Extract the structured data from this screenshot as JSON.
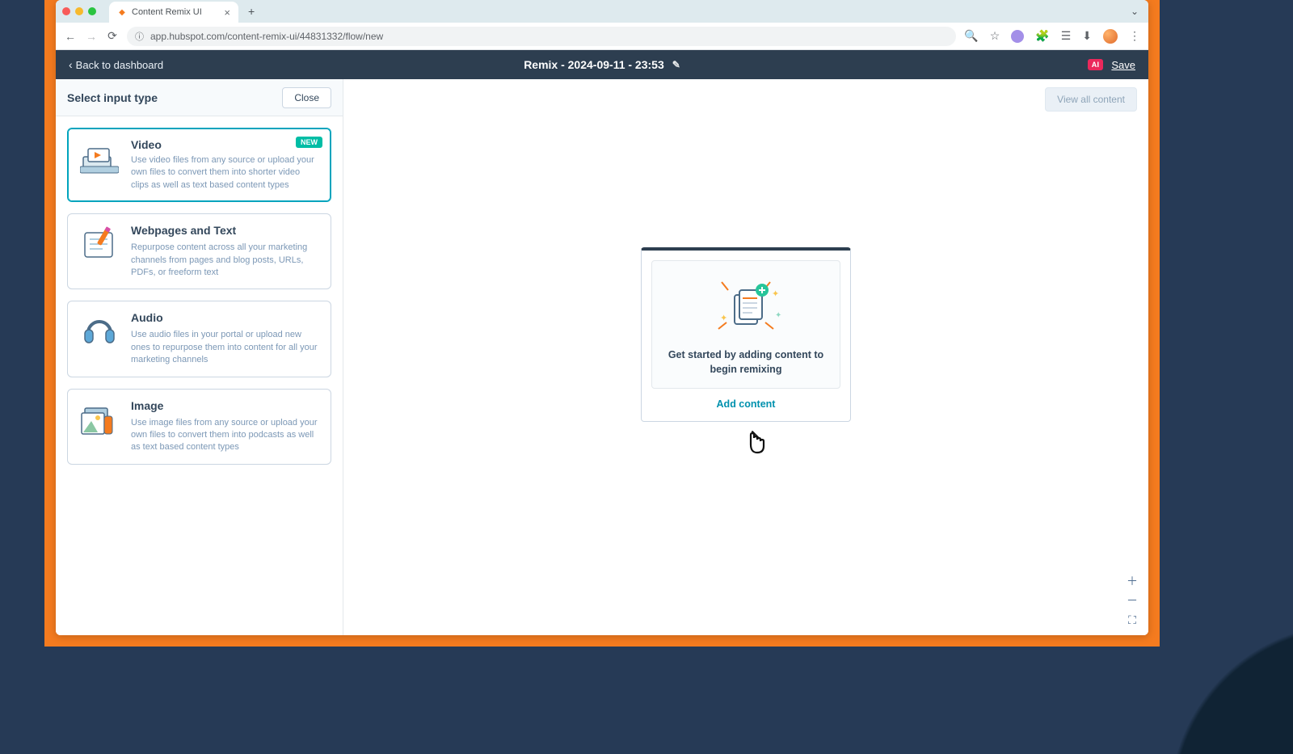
{
  "browser": {
    "tab_title": "Content Remix UI",
    "url": "app.hubspot.com/content-remix-ui/44831332/flow/new"
  },
  "header": {
    "back_label": "Back to dashboard",
    "title": "Remix - 2024-09-11 - 23:53",
    "ai_badge": "AI",
    "save_label": "Save"
  },
  "sidebar": {
    "title": "Select input type",
    "close_label": "Close",
    "items": [
      {
        "title": "Video",
        "badge": "NEW",
        "desc": "Use video files from any source or upload your own files to convert them into shorter video clips as well as text based content types"
      },
      {
        "title": "Webpages and Text",
        "desc": "Repurpose content across all your marketing channels from pages and blog posts, URLs, PDFs, or freeform text"
      },
      {
        "title": "Audio",
        "desc": "Use audio files in your portal or upload new ones to repurpose them into content for all your marketing channels"
      },
      {
        "title": "Image",
        "desc": "Use image files from any source or upload your own files to convert them into podcasts as well as text based content types"
      }
    ]
  },
  "canvas": {
    "view_all_label": "View all content",
    "empty_text_line1": "Get started by adding content to",
    "empty_text_line2": "begin remixing",
    "add_content_label": "Add content"
  }
}
